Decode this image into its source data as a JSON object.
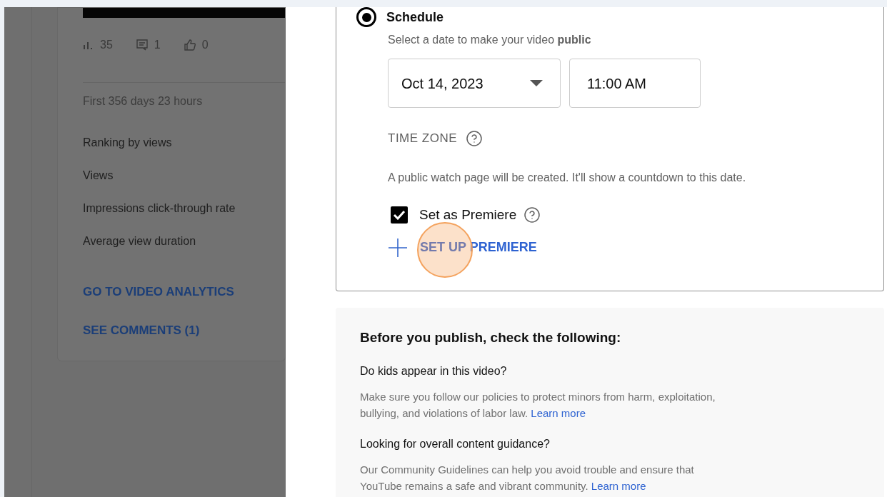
{
  "video_card": {
    "stats": [
      {
        "kind": "views",
        "value": "35"
      },
      {
        "kind": "comments",
        "value": "1"
      },
      {
        "kind": "likes",
        "value": "0"
      }
    ],
    "period": "First 356 days 23 hours",
    "metrics": [
      "Ranking by views",
      "Views",
      "Impressions click-through rate",
      "Average view duration"
    ],
    "links": [
      "GO TO VIDEO ANALYTICS",
      "SEE COMMENTS (1)"
    ]
  },
  "schedule": {
    "label": "Schedule",
    "selected": true,
    "description": "Select a date to make your video **public**",
    "date": "Oct 14, 2023",
    "time": "11:00 AM",
    "time_zone_label": "TIME ZONE",
    "note": "A public watch page will be created. It'll show a countdown to this date.",
    "premiere": {
      "label": "Set as Premiere",
      "checked": true
    },
    "setup_button": "SET UP PREMIERE"
  },
  "checklist": {
    "title": "Before you publish, check the following:",
    "items": [
      {
        "question": "Do kids appear in this video?",
        "text": "Make sure you follow our policies to protect minors from harm, exploitation, bullying, and violations of labor law.",
        "link": "Learn more"
      },
      {
        "question": "Looking for overall content guidance?",
        "text": "Our Community Guidelines can help you avoid trouble and ensure that YouTube remains a safe and vibrant community.",
        "link": "Learn more"
      }
    ]
  }
}
